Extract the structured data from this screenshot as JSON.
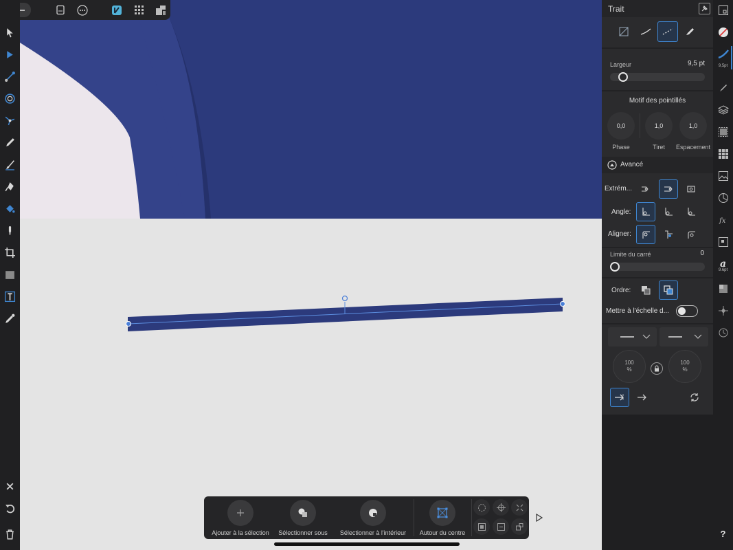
{
  "toolbar_top": {
    "icons": [
      "back-arrow-icon",
      "document-icon",
      "more-icon",
      "designer-persona-icon",
      "grid-icon",
      "export-persona-icon"
    ]
  },
  "left_tools": [
    "move-tool",
    "node-tool",
    "gradient-tool",
    "transparency-tool",
    "point-transform-tool",
    "pencil-tool",
    "vector-brush-tool",
    "pen-tool",
    "fill-tool",
    "pixel-brush-tool",
    "crop-tool",
    "rectangle-tool",
    "artistic-text-tool",
    "color-picker-tool"
  ],
  "left_bottom": [
    "close-icon",
    "undo-icon",
    "delete-icon"
  ],
  "panel": {
    "title": "Trait",
    "width_label": "Largeur",
    "width_value": "9,5 pt",
    "width_fraction": 0.1,
    "dash_title": "Motif des pointillés",
    "dash": [
      {
        "value": "0,0",
        "label": "Phase"
      },
      {
        "value": "1,0",
        "label": "Tiret"
      },
      {
        "value": "1,0",
        "label": "Espacement"
      }
    ],
    "advanced_label": "Avancé",
    "caps_label": "Extrém...",
    "angle_label": "Angle:",
    "align_label": "Aligner:",
    "miter_label": "Limite du carré",
    "miter_value": "0",
    "miter_fraction": 0,
    "order_label": "Ordre:",
    "scale_label": "Mettre à l'échelle d...",
    "scale_on": false,
    "arrow_scale_left": "100",
    "arrow_scale_right": "100",
    "percent": "%"
  },
  "studio": {
    "brush_size_label": "9,5pt",
    "text_size_label": "9.6pt",
    "help": "?"
  },
  "context_toolbar": {
    "add": "Ajouter à la sélection",
    "below": "Sélectionner sous",
    "inside": "Sélectionner à l'intérieur",
    "center": "Autour du centre"
  },
  "colors": {
    "navy": "#2c3a7c",
    "accent": "#3f86d1",
    "selection": "#4a7fd8"
  }
}
